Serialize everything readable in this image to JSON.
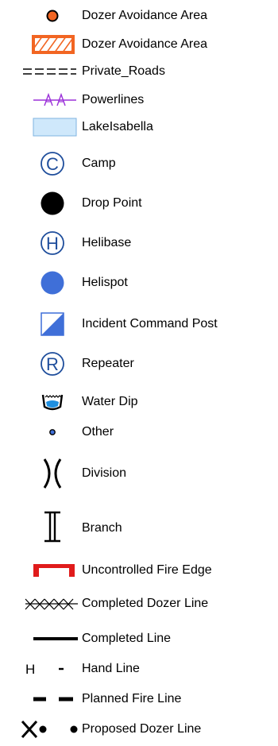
{
  "legend": {
    "items": [
      {
        "label": "Dozer Avoidance Area",
        "symbol": "orange-dot-icon"
      },
      {
        "label": "Dozer Avoidance Area",
        "symbol": "orange-hatched-area-icon"
      },
      {
        "label": "Private_Roads",
        "symbol": "dashed-road-icon"
      },
      {
        "label": "Powerlines",
        "symbol": "powerline-icon"
      },
      {
        "label": "LakeIsabella",
        "symbol": "lake-area-icon"
      },
      {
        "label": "Camp",
        "symbol": "camp-icon",
        "glyph": "C"
      },
      {
        "label": "Drop Point",
        "symbol": "drop-point-icon"
      },
      {
        "label": "Helibase",
        "symbol": "helibase-icon",
        "glyph": "H"
      },
      {
        "label": "Helispot",
        "symbol": "helispot-icon"
      },
      {
        "label": "Incident Command Post",
        "symbol": "incident-command-post-icon"
      },
      {
        "label": "Repeater",
        "symbol": "repeater-icon",
        "glyph": "R"
      },
      {
        "label": "Water Dip",
        "symbol": "water-dip-icon"
      },
      {
        "label": "Other",
        "symbol": "other-point-icon"
      },
      {
        "label": "Division",
        "symbol": "division-icon"
      },
      {
        "label": "Branch",
        "symbol": "branch-icon"
      },
      {
        "label": "Uncontrolled Fire Edge",
        "symbol": "uncontrolled-fire-edge-icon"
      },
      {
        "label": "Completed Dozer Line",
        "symbol": "completed-dozer-line-icon"
      },
      {
        "label": "Completed Line",
        "symbol": "completed-line-icon"
      },
      {
        "label": "Hand Line",
        "symbol": "hand-line-icon",
        "glyph": "H"
      },
      {
        "label": "Planned Fire Line",
        "symbol": "planned-fire-line-icon"
      },
      {
        "label": "Proposed Dozer Line",
        "symbol": "proposed-dozer-line-icon"
      }
    ]
  },
  "colors": {
    "orange": "#f26522",
    "purple": "#9b30d9",
    "lake_fill": "#cfe8fb",
    "lake_stroke": "#7fb3e0",
    "blue": "#1f4e9c",
    "helispot": "#3f6fd8",
    "red": "#e01b1b"
  }
}
